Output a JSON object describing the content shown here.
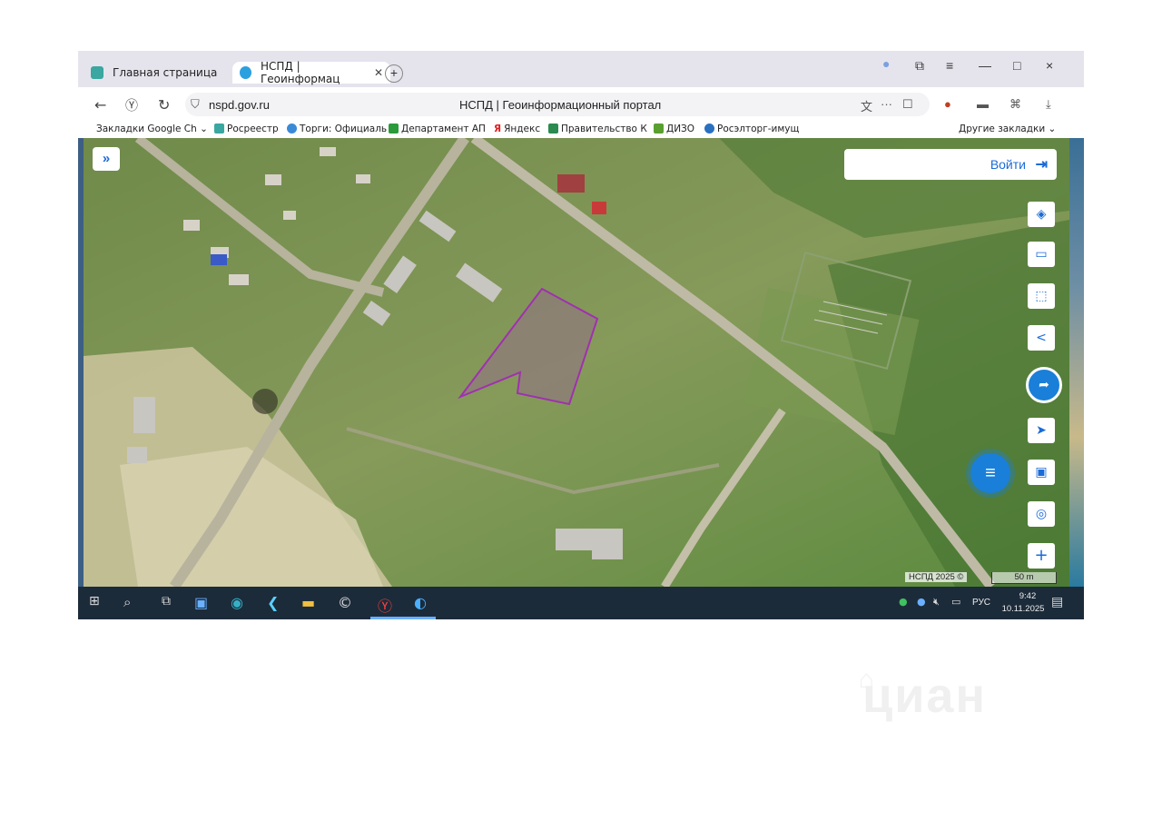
{
  "browser": {
    "tabs": [
      {
        "label": "Главная страница",
        "active": false
      },
      {
        "label": "НСПД | Геоинформац",
        "active": true
      }
    ],
    "new_tab_icon": "plus-icon",
    "window_controls": [
      "—",
      "□",
      "×"
    ],
    "url": "nspd.gov.ru",
    "page_title": "НСПД | Геоинформационный портал",
    "bookmarks": [
      {
        "label": "Закладки Google Ch",
        "icon": "folder-icon"
      },
      {
        "label": "Росреестр",
        "icon": "rosreestr-icon"
      },
      {
        "label": "Торги: Официаль",
        "icon": "torgi-icon"
      },
      {
        "label": "Департамент АП",
        "icon": "dept-icon"
      },
      {
        "label": "Яндекс",
        "icon": "yandex-icon"
      },
      {
        "label": "Правительство К",
        "icon": "gov-icon"
      },
      {
        "label": "ДИЗО",
        "icon": "dizo-icon"
      },
      {
        "label": "Росэлторг-имущ",
        "icon": "roseltorg-icon"
      }
    ],
    "other_bookmarks": "Другие закладки"
  },
  "map": {
    "login_label": "Войти",
    "attribution": "НСПД 2025 ©",
    "scale_label": "50 m",
    "tools": [
      "layers-icon",
      "ruler-icon",
      "select-area-icon",
      "share-icon",
      "nspd-logo-icon",
      "locate-icon",
      "screen-icon",
      "search-point-icon",
      "zoom-in-icon"
    ],
    "parcel_color": "#a030b0"
  },
  "taskbar": {
    "lang": "РУС",
    "time": "9:42",
    "date": "10.11.2025"
  },
  "watermark": "циан"
}
